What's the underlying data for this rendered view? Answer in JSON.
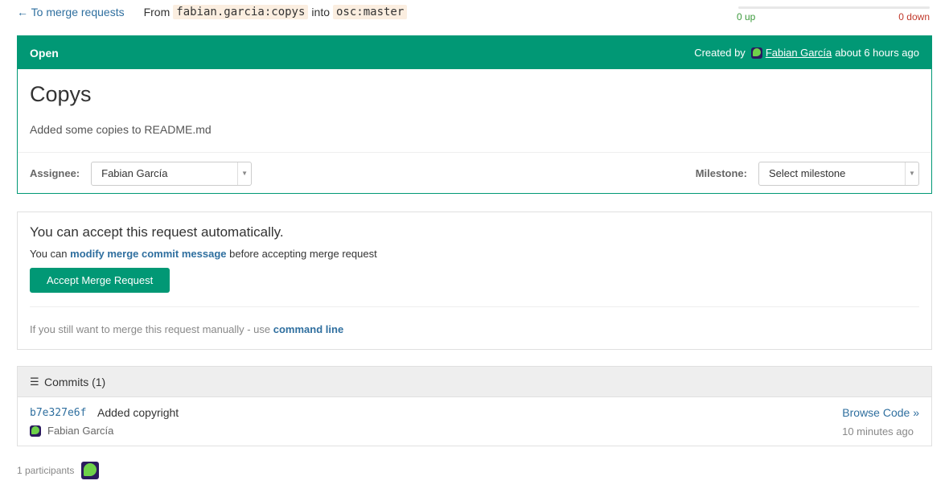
{
  "top": {
    "back_link": "← To merge requests",
    "from_label": "From",
    "source_branch": "fabian.garcia:copys",
    "into_label": "into",
    "target_branch": "osc:master"
  },
  "votes": {
    "up": "0 up",
    "down": "0 down",
    "up_fraction": 0
  },
  "mr": {
    "state": "Open",
    "created_by_label": "Created by",
    "author": "Fabian García",
    "created_ago": "about 6 hours ago",
    "title": "Copys",
    "description": "Added some copies to README.md",
    "assignee_label": "Assignee:",
    "assignee_value": "Fabian García",
    "milestone_label": "Milestone:",
    "milestone_value": "Select milestone"
  },
  "accept": {
    "title": "You can accept this request automatically.",
    "sub_prefix": "You can",
    "modify_link": "modify merge commit message",
    "sub_suffix": "before accepting merge request",
    "button": "Accept Merge Request",
    "manual_text": "If you still want to merge this request manually - use",
    "command_line_link": "command line"
  },
  "commits": {
    "header": "Commits (1)",
    "items": [
      {
        "sha": "b7e327e6f",
        "message": "Added copyright",
        "author": "Fabian García",
        "browse": "Browse Code »",
        "time": "10 minutes ago"
      }
    ]
  },
  "participants": {
    "label": "1 participants"
  },
  "colors": {
    "accent": "#019875",
    "link": "#2f6f9f",
    "branch_bg": "#fbeee0"
  }
}
